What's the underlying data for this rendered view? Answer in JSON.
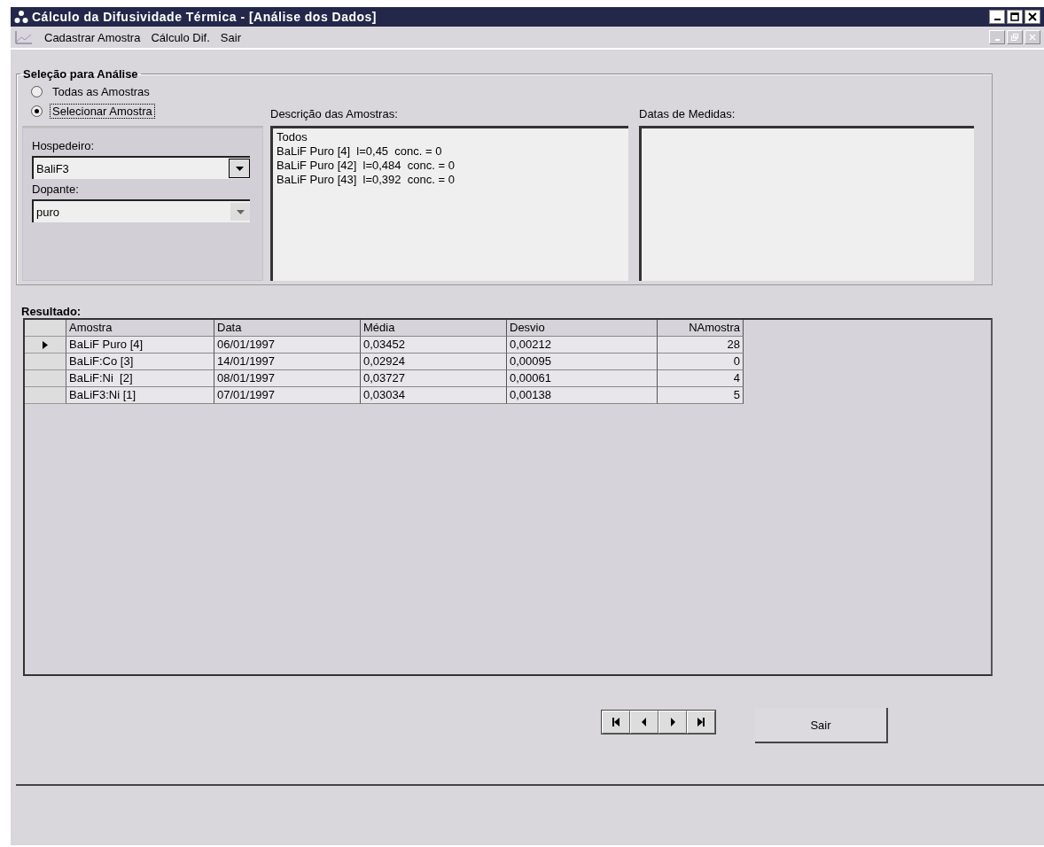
{
  "window": {
    "title": "Cálculo da Difusividade Térmica - [Análise dos Dados]"
  },
  "menu": [
    "Cadastrar Amostra",
    "Cálculo Dif.",
    "Sair"
  ],
  "selection": {
    "title": "Seleção para Análise",
    "radios": [
      {
        "label": "Todas as Amostras",
        "selected": false
      },
      {
        "label": "Selecionar Amostra",
        "selected": true
      }
    ],
    "host": {
      "label": "Hospedeiro:",
      "value": "BaliF3"
    },
    "dopant": {
      "label": "Dopante:",
      "value": "puro"
    },
    "description": {
      "label": "Descrição das Amostras:",
      "items": [
        "Todos",
        "BaLiF Puro [4]  l=0,45  conc. = 0",
        "BaLiF Puro [42]  l=0,484  conc. = 0",
        "BaLiF Puro [43]  l=0,392  conc. = 0"
      ]
    },
    "dates": {
      "label": "Datas de Medidas:"
    }
  },
  "result": {
    "title": "Resultado:",
    "columns": [
      "Amostra",
      "Data",
      "Média",
      "Desvio",
      "NAmostra"
    ],
    "rows": [
      {
        "selected": true,
        "cells": [
          "BaLiF Puro [4]",
          "06/01/1997",
          "0,03452",
          "0,00212",
          "28"
        ]
      },
      {
        "selected": false,
        "cells": [
          "BaLiF:Co [3]",
          "14/01/1997",
          "0,02924",
          "0,00095",
          "0"
        ]
      },
      {
        "selected": false,
        "cells": [
          "BaLiF:Ni  [2]",
          "08/01/1997",
          "0,03727",
          "0,00061",
          "4"
        ]
      },
      {
        "selected": false,
        "cells": [
          "BaLiF3:Ni [1]",
          "07/01/1997",
          "0,03034",
          "0,00138",
          "5"
        ]
      }
    ]
  },
  "exit_button": "Sair"
}
